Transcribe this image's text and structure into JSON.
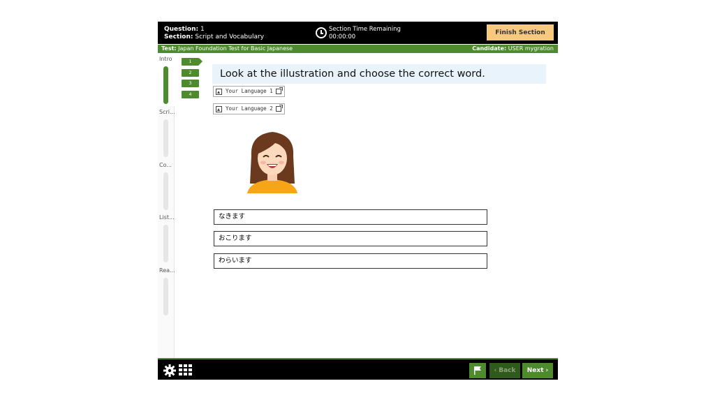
{
  "header": {
    "question_label": "Question:",
    "question_value": "1",
    "section_label": "Section:",
    "section_value": "Script and Vocabulary",
    "timer_label": "Section Time Remaining",
    "timer_value": "00:00:00",
    "finish_label": "Finish Section"
  },
  "infobar": {
    "test_label": "Test:",
    "test_value": "Japan Foundation Test for Basic Japanese",
    "candidate_label": "Candidate:",
    "candidate_value": "USER mygration"
  },
  "sections": [
    {
      "label": "Intro",
      "active": true
    },
    {
      "label": "Scri...",
      "active": false
    },
    {
      "label": "Co...",
      "active": false
    },
    {
      "label": "List...",
      "active": false
    },
    {
      "label": "Rea...",
      "active": false
    }
  ],
  "questions": [
    "1",
    "2",
    "3",
    "4"
  ],
  "main": {
    "instruction": "Look at the illustration and choose the correct word.",
    "language_buttons": [
      "Your Language 1",
      "Your Language 2"
    ],
    "options": [
      "なきます",
      "おこります",
      "わらいます"
    ]
  },
  "footer": {
    "back_label": "Back",
    "next_label": "Next"
  },
  "colors": {
    "accent_green": "#4e8a2e",
    "finish_button": "#f7c97e",
    "instruction_bg": "#e8f3fb"
  }
}
